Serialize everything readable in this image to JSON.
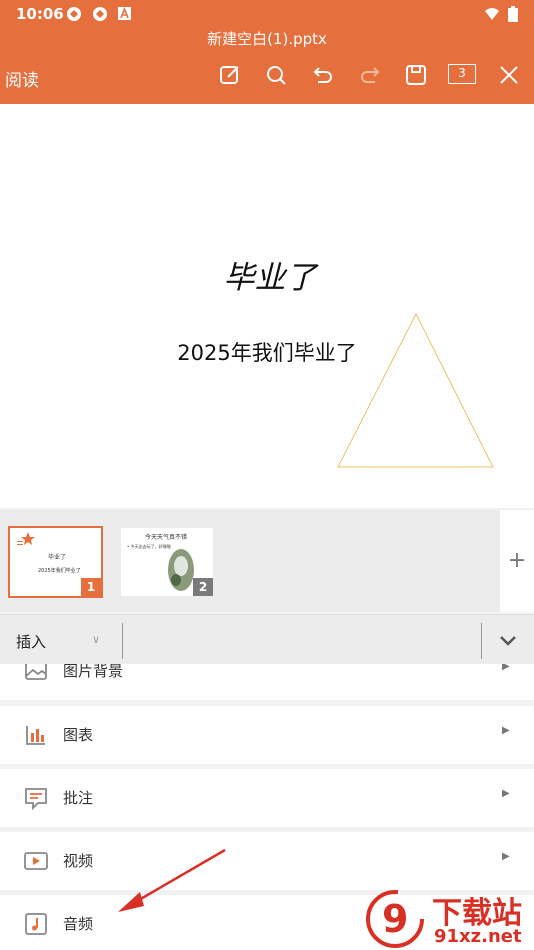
{
  "status_bar": {
    "time": "10:06"
  },
  "app_bar": {
    "title": "新建空白(1).pptx",
    "read_label": "阅读",
    "page_count": "3",
    "tools": [
      "edit-icon",
      "search-icon",
      "undo-icon",
      "redo-icon",
      "save-icon",
      "page-count-icon",
      "close-icon"
    ]
  },
  "slide": {
    "title": "毕业了",
    "subtitle": "2025年我们毕业了",
    "shape_color": "#f0c060"
  },
  "thumbnails": [
    {
      "number": "1",
      "title": "毕业了",
      "subtitle": "2025年我们毕业了"
    },
    {
      "number": "2",
      "title": "今天天气真不错",
      "bullet": "• 今天出去玩了，好嘿嘿"
    }
  ],
  "add_slide_label": "+",
  "mode_bar": {
    "label": "插入"
  },
  "menu": {
    "items": [
      {
        "label": "图片背景",
        "icon": "image-icon"
      },
      {
        "label": "图表",
        "icon": "chart-icon"
      },
      {
        "label": "批注",
        "icon": "comment-icon"
      },
      {
        "label": "视频",
        "icon": "video-icon"
      },
      {
        "label": "音频",
        "icon": "audio-icon"
      }
    ]
  },
  "watermark": {
    "main": "下载站",
    "url": "91xz.net",
    "logo": "9"
  },
  "colors": {
    "accent": "#e56f3d",
    "panel_bg": "#f2f2f2",
    "arrow": "#d93025"
  }
}
